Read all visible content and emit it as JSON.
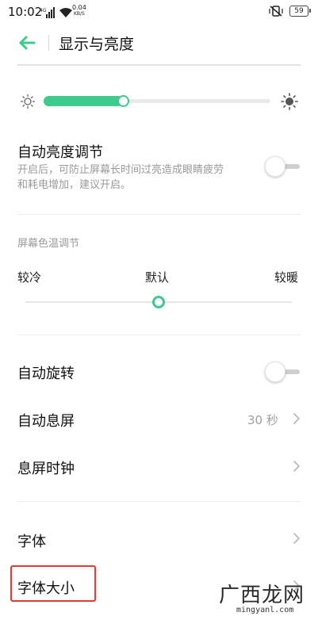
{
  "status_bar": {
    "time": "10:02",
    "network_type": "4G",
    "net_speed_value": "0.04",
    "net_speed_unit": "KB/S",
    "battery": "59"
  },
  "header": {
    "title": "显示与亮度"
  },
  "brightness": {
    "level": 0.35,
    "accent_color": "#3ccb8a"
  },
  "auto_brightness": {
    "title": "自动亮度调节",
    "description_line1": "开启后，可防止屏幕长时间过亮造成眼睛疲劳",
    "description_line2": "和耗电增加，建议开启。",
    "enabled": false
  },
  "color_temperature": {
    "section_label": "屏幕色温调节",
    "cool_label": "较冷",
    "default_label": "默认",
    "warm_label": "较暖",
    "level": 0.5
  },
  "auto_rotate": {
    "title": "自动旋转",
    "enabled": false
  },
  "screen_timeout": {
    "title": "自动息屏",
    "value": "30 秒"
  },
  "screen_off_clock": {
    "title": "息屏时钟"
  },
  "font": {
    "title": "字体"
  },
  "font_size": {
    "title": "字体大小"
  },
  "watermark": {
    "text": "广西龙网",
    "url": "mingyanl.com"
  },
  "icons": {
    "back": "back-arrow-icon",
    "brightness_low": "sun-small-icon",
    "brightness_high": "sun-large-icon",
    "chevron": "chevron-right-icon"
  }
}
